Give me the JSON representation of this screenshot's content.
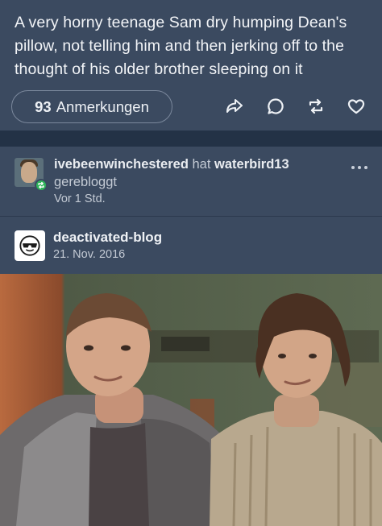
{
  "post": {
    "text": "A very horny teenage Sam dry humping Dean's pillow, not telling him and then jerking off to the thought of his older brother sleeping on it",
    "notes_count": "93",
    "notes_label": "Anmerkungen",
    "actions": [
      "share-icon",
      "reply-icon",
      "reblog-icon",
      "like-icon"
    ]
  },
  "reblog": {
    "user": "ivebeenwinchestered",
    "hat": "hat",
    "source": "waterbird13",
    "action": "gerebloggt",
    "time": "Vor 1 Std.",
    "menu_icon": "more-dots-icon"
  },
  "original": {
    "blog": "deactivated-blog",
    "date": "21. Nov. 2016",
    "avatar_icon": "sunglasses-face-icon"
  },
  "colors": {
    "card_bg": "#3b4a60",
    "band_bg": "#233246",
    "reblog_green": "#2fb45a"
  }
}
